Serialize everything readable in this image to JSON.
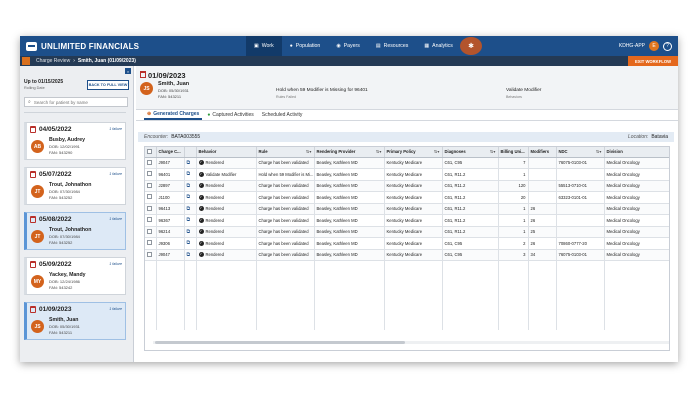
{
  "app": {
    "name": "UNLIMITED FINANCIALS",
    "nav": [
      "Work",
      "Population",
      "Payers",
      "Resources",
      "Analytics"
    ],
    "user": "KDHG-APP",
    "user_initial": "E",
    "help": "?"
  },
  "subbar": {
    "crumb": "Charge Review",
    "title": "Smith, Juan (01/09/2023)",
    "exit_button": "EXIT WORKFLOW"
  },
  "left_panel": {
    "close": "×",
    "up_to": "Up to 01/15/2025",
    "rolling": "Rolling Date",
    "full_view_button": "BACK TO FULL VIEW",
    "search_placeholder": "Search for patient by name",
    "cards": [
      {
        "date": "04/05/2022",
        "failure": "1 failure",
        "initials": "AB",
        "name": "Busby, Audrey",
        "dob": "DOB: 12/02/1991",
        "fan": "FAN: 543290",
        "selected": false
      },
      {
        "date": "05/07/2022",
        "failure": "1 failure",
        "initials": "JT",
        "name": "Trout, Johnathon",
        "dob": "DOB: 07/30/1984",
        "fan": "FAN: 543252",
        "selected": false
      },
      {
        "date": "05/08/2022",
        "failure": "1 failure",
        "initials": "JT",
        "name": "Trout, Johnathon",
        "dob": "DOB: 07/30/1984",
        "fan": "FAN: 543252",
        "selected": true
      },
      {
        "date": "05/09/2022",
        "failure": "1 failure",
        "initials": "MY",
        "name": "Yackey, Mandy",
        "dob": "DOB: 12/24/1986",
        "fan": "FAN: 543242",
        "selected": false
      },
      {
        "date": "01/09/2023",
        "failure": "1 failure",
        "initials": "JS",
        "name": "Smith, Juan",
        "dob": "DOB: 05/30/1931",
        "fan": "FAN: 543211",
        "selected": true
      }
    ]
  },
  "patient": {
    "date": "01/09/2023",
    "initials": "JS",
    "name": "Smith, Juan",
    "dob": "DOB: 05/30/1931",
    "fan": "FAN: 543211",
    "rule": "Hold when 59 Modifier is Missing for 96401",
    "rule_sub": "Rules Failed",
    "behavior": "Validate Modifier",
    "behavior_sub": "Behaviors"
  },
  "tabs": [
    "Generated Charges",
    "Captured Activities",
    "Scheduled Activity"
  ],
  "encounter": {
    "label": "Encounter:",
    "value": "BATA003555",
    "location_label": "Location:",
    "location": "Batavia"
  },
  "table": {
    "headers": [
      "Charge C...",
      "Behavior",
      "Rule",
      "Rendering Provider",
      "Primary Policy",
      "Diagnoses",
      "Billing Uni...",
      "Modifiers",
      "NDC",
      "Division"
    ],
    "rows": [
      {
        "code": "J9047",
        "behavior": "Rendered",
        "rule": "Charge has been validated",
        "provider": "Beasley, Kathleen MD",
        "policy": "Kentucky Medicare",
        "dx": "C61, C95",
        "units": "7",
        "mod": "",
        "ndc": "76075-0103-01",
        "division": "Medical Oncology"
      },
      {
        "code": "96401",
        "behavior": "Validate Modifier",
        "rule": "Hold when 59 Modifier is Mi...",
        "provider": "Beasley, Kathleen MD",
        "policy": "Kentucky Medicare",
        "dx": "C61, R11.2",
        "units": "1",
        "mod": "",
        "ndc": "",
        "division": "Medical Oncology"
      },
      {
        "code": "J2897",
        "behavior": "Rendered",
        "rule": "Charge has been validated",
        "provider": "Beasley, Kathleen MD",
        "policy": "Kentucky Medicare",
        "dx": "C61, R11.2",
        "units": "120",
        "mod": "",
        "ndc": "55513-0710-01",
        "division": "Medical Oncology"
      },
      {
        "code": "J1100",
        "behavior": "Rendered",
        "rule": "Charge has been validated",
        "provider": "Beasley, Kathleen MD",
        "policy": "Kentucky Medicare",
        "dx": "C61, R11.2",
        "units": "20",
        "mod": "",
        "ndc": "63323-0101-01",
        "division": "Medical Oncology"
      },
      {
        "code": "96413",
        "behavior": "Rendered",
        "rule": "Charge has been validated",
        "provider": "Beasley, Kathleen MD",
        "policy": "Kentucky Medicare",
        "dx": "C61, R11.2",
        "units": "1",
        "mod": "26",
        "ndc": "",
        "division": "Medical Oncology"
      },
      {
        "code": "96367",
        "behavior": "Rendered",
        "rule": "Charge has been validated",
        "provider": "Beasley, Kathleen MD",
        "policy": "Kentucky Medicare",
        "dx": "C61, R11.2",
        "units": "1",
        "mod": "26",
        "ndc": "",
        "division": "Medical Oncology"
      },
      {
        "code": "96214",
        "behavior": "Rendered",
        "rule": "Charge has been validated",
        "provider": "Beasley, Kathleen MD",
        "policy": "Kentucky Medicare",
        "dx": "C61, R11.2",
        "units": "1",
        "mod": "25",
        "ndc": "",
        "division": "Medical Oncology"
      },
      {
        "code": "J9306",
        "behavior": "Rendered",
        "rule": "Charge has been validated",
        "provider": "Beasley, Kathleen MD",
        "policy": "Kentucky Medicare",
        "dx": "C61, C95",
        "units": "2",
        "mod": "26",
        "ndc": "70860-0777-20",
        "division": "Medical Oncology"
      },
      {
        "code": "J9047",
        "behavior": "Rendered",
        "rule": "Charge has been validated",
        "provider": "Beasley, Kathleen MD",
        "policy": "Kentucky Medicare",
        "dx": "C61, C95",
        "units": "3",
        "mod": "34",
        "ndc": "76075-0103-01",
        "division": "Medical Oncology"
      }
    ]
  },
  "colors": {
    "topbar": "#1d4f8a",
    "subbar": "#243a55",
    "accent": "#e4681d",
    "avatar": "#d3631d"
  }
}
